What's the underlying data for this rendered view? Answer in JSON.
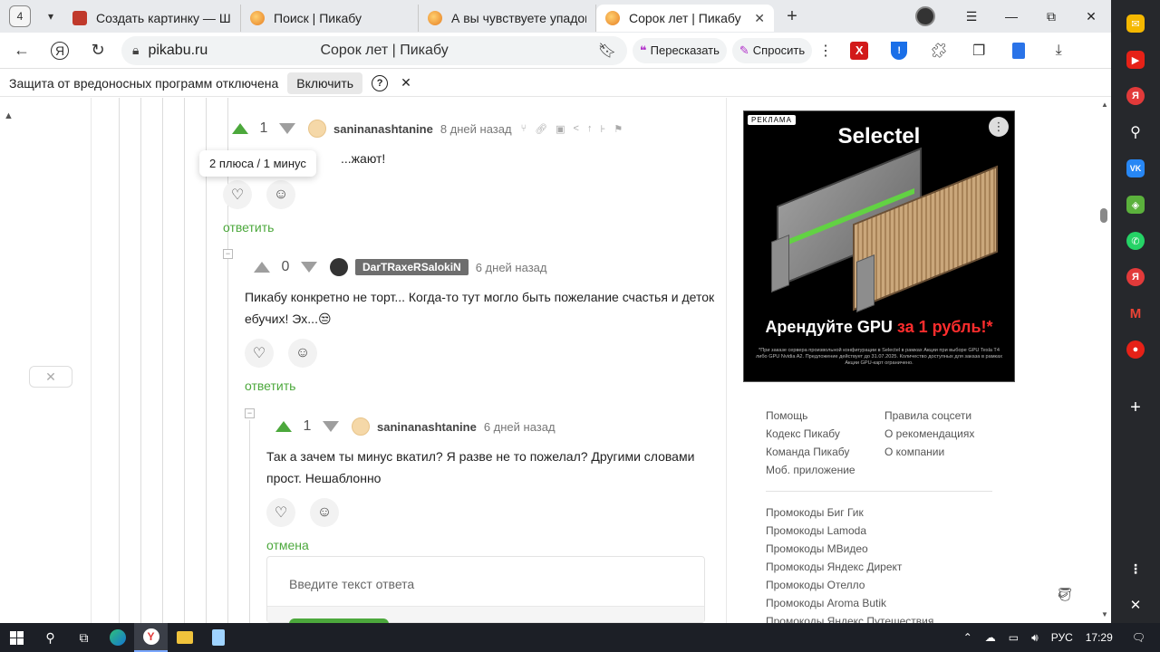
{
  "tabs": {
    "count": "4",
    "items": [
      {
        "title": "Создать картинку — Шед",
        "color": "#c0392b"
      },
      {
        "title": "Поиск | Пикабу",
        "color": "#f39c12"
      },
      {
        "title": "А вы чувствуете упадок с",
        "color": "#e67e22"
      },
      {
        "title": "Сорок лет | Пикабу",
        "color": "#e67e22",
        "active": true
      }
    ],
    "close_symbol": "✕",
    "new_tab_symbol": "+"
  },
  "window_controls": {
    "menu": "☰",
    "minimize": "—",
    "restore": "⧉",
    "close": "✕"
  },
  "addressbar": {
    "domain": "pikabu.ru",
    "page_title": "Сорок лет | Пикабу",
    "retell_label": "Пересказать",
    "ask_label": "Спросить"
  },
  "protection_bar": {
    "message": "Защита от вредоносных программ отключена",
    "enable_label": "Включить",
    "help_symbol": "?",
    "close_symbol": "✕"
  },
  "comments": [
    {
      "votes": "1",
      "vote_up_color": "#4ca83c",
      "username": "saninanashtanine",
      "date": "8 дней назад",
      "text": "...жают!",
      "reply_label": "ответить"
    },
    {
      "votes": "0",
      "username": "DarTRaxeRSalokiN",
      "date": "6 дней назад",
      "text": "Пикабу конкретно не торт... Когда-то тут могло быть пожелание счастья и деток ебучих! Эх...😒",
      "reply_label": "ответить"
    },
    {
      "votes": "1",
      "vote_up_color": "#4ca83c",
      "username": "saninanashtanine",
      "date": "6 дней назад",
      "text": "Так а зачем ты минус вкатил? Я разве не то пожелал? Другими словами прост. Нешаблонно",
      "reply_label": "отмена"
    }
  ],
  "tooltip": "2 плюса / 1 минус",
  "reply_box": {
    "placeholder": "Введите текст ответа"
  },
  "ad": {
    "label": "РЕКЛАМА",
    "brand": "Selectel",
    "headline_start": "Арендуйте GPU ",
    "headline_accent": "за 1 рубль!*",
    "accent_color": "#ff2d2d",
    "fine_print": "*При заказе сервера произвольной конфигурации в Selectel в рамках Акции при выборе GPU Tesla T4 либо GPU Nvidia A2. Предложение действует до 31.07.2025. Количество доступных для заказа в рамках Акции GPU-карт ограничено."
  },
  "sidebar_links": {
    "col1": [
      "Помощь",
      "Кодекс Пикабу",
      "Команда Пикабу",
      "Моб. приложение"
    ],
    "col2": [
      "Правила соцсети",
      "О рекомендациях",
      "О компании"
    ],
    "promos": [
      "Промокоды Биг Гик",
      "Промокоды Lamoda",
      "Промокоды МВидео",
      "Промокоды Яндекс Директ",
      "Промокоды Отелло",
      "Промокоды Aroma Butik",
      "Промокоды Яндекс Путешествия"
    ]
  },
  "sidepanel": {
    "icons": [
      {
        "name": "mail-icon",
        "color": "#f5b800",
        "glyph": "✉"
      },
      {
        "name": "youtube-icon",
        "color": "#e62117",
        "glyph": "▶"
      },
      {
        "name": "yandex-icon",
        "color": "#e23a3a",
        "glyph": "Я"
      },
      {
        "name": "search-icon",
        "color": "#26282c",
        "glyph": "⚲"
      },
      {
        "name": "vk-icon",
        "color": "#2787f5",
        "glyph": "VK"
      },
      {
        "name": "games-icon",
        "color": "#5bb13c",
        "glyph": "◈"
      },
      {
        "name": "whatsapp-icon",
        "color": "#25d366",
        "glyph": "✆"
      },
      {
        "name": "yandex-alt-icon",
        "color": "#e23a3a",
        "glyph": "Я"
      },
      {
        "name": "gmail-icon",
        "color": "#26282c",
        "glyph": "M"
      },
      {
        "name": "music-icon",
        "color": "#e62117",
        "glyph": "●"
      }
    ],
    "add_symbol": "+",
    "more_symbol": "⋮",
    "close_symbol": "✕"
  },
  "taskbar": {
    "language": "РУС",
    "time": "17:29"
  }
}
